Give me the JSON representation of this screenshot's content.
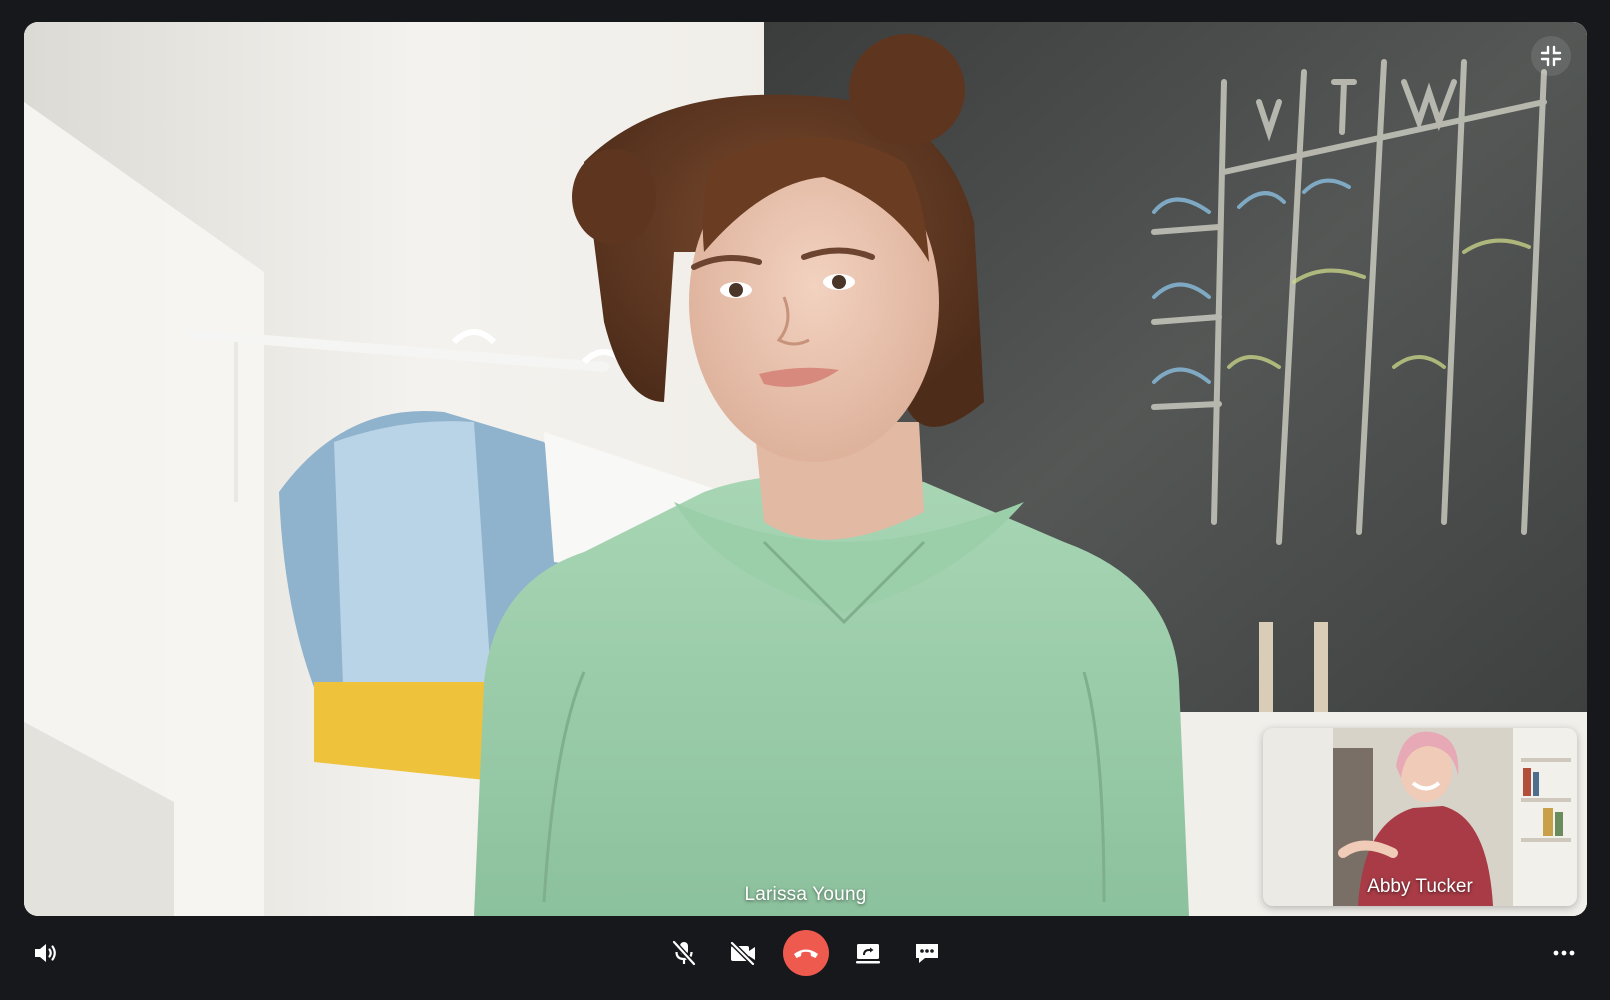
{
  "call": {
    "main_participant": {
      "name": "Larissa Young"
    },
    "self_view": {
      "name": "Abby Tucker"
    }
  },
  "controls": {
    "left": [
      {
        "icon": "speaker-icon"
      }
    ],
    "center": [
      {
        "icon": "mic-off-icon"
      },
      {
        "icon": "camera-off-icon"
      },
      {
        "icon": "end-call-icon",
        "color": "#ef5a4e"
      },
      {
        "icon": "share-screen-icon"
      },
      {
        "icon": "chat-icon"
      }
    ],
    "right": [
      {
        "icon": "more-icon"
      }
    ],
    "overlay": [
      {
        "icon": "collapse-icon"
      }
    ]
  },
  "theme": {
    "background": "#16181c",
    "end_call": "#ef5a4e",
    "text": "#ffffff"
  }
}
